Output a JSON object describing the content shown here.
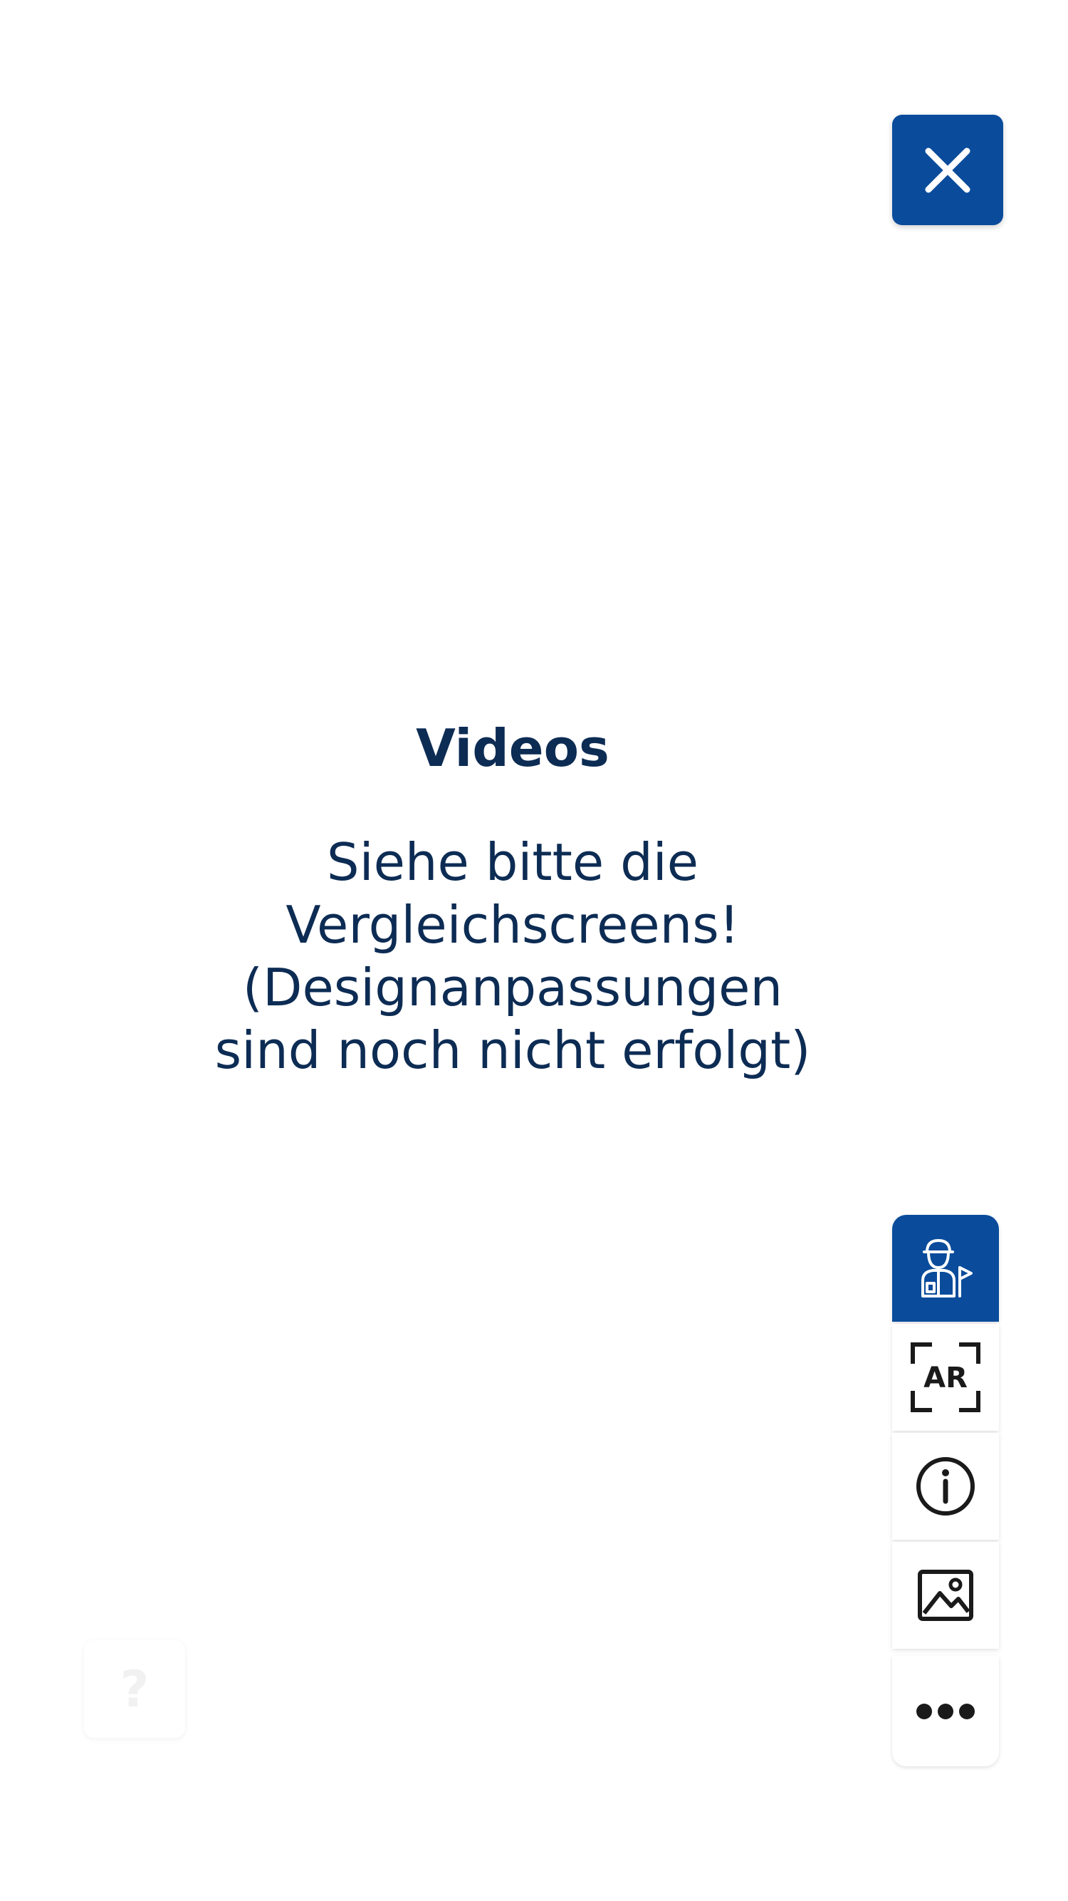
{
  "header": {
    "close_icon": "close-icon"
  },
  "content": {
    "title": "Videos",
    "message": "Siehe bitte die\nVergleichscreens!\n(Designanpassungen\nsind noch nicht erfolgt)"
  },
  "toolbar": {
    "items": [
      {
        "icon": "guide-person-flag-icon",
        "active": true
      },
      {
        "icon": "ar-scan-icon",
        "label": "AR",
        "active": false
      },
      {
        "icon": "info-icon",
        "active": false
      },
      {
        "icon": "image-gallery-icon",
        "active": false
      },
      {
        "icon": "more-icon",
        "active": false
      }
    ]
  },
  "help": {
    "icon": "help-icon",
    "label": "?"
  },
  "colors": {
    "accent": "#0a4c9b",
    "text": "#0d2c54",
    "background": "#ffffff"
  }
}
